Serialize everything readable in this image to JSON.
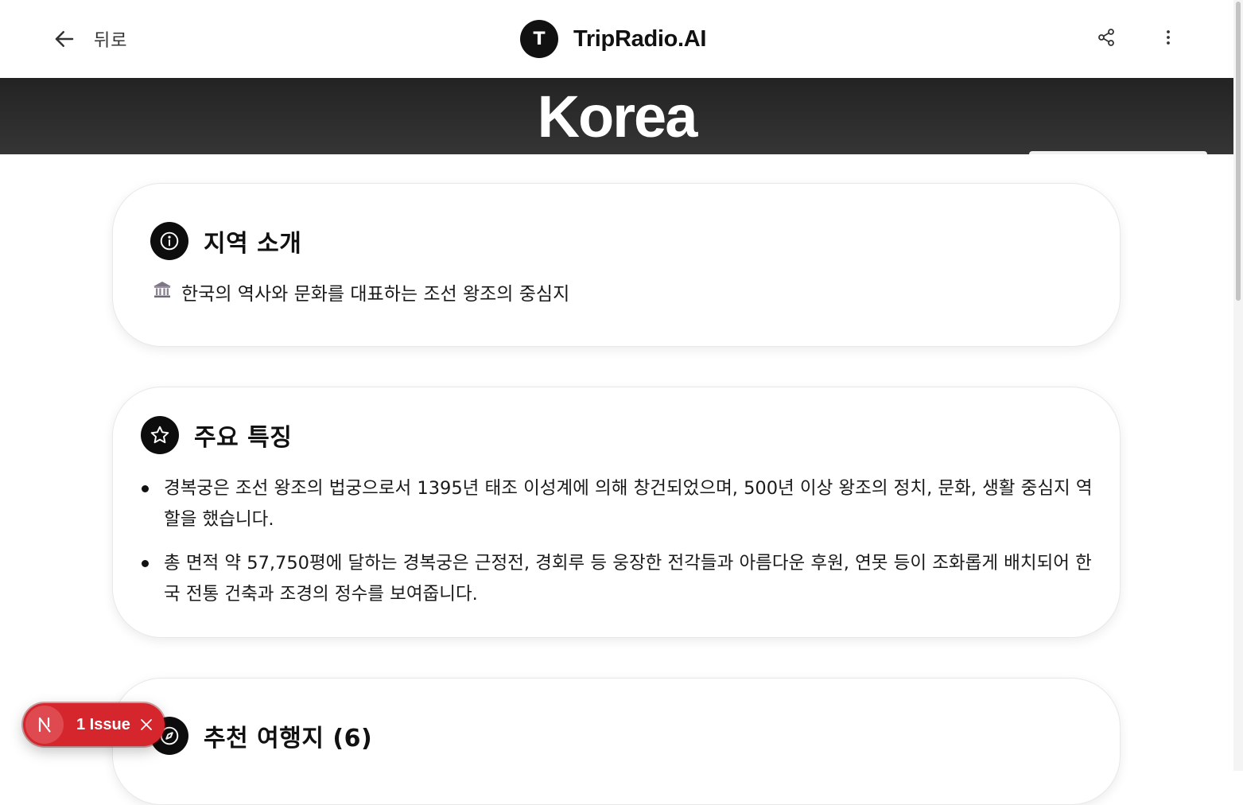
{
  "header": {
    "back_label": "뒤로",
    "brand_initial": "T",
    "brand_name": "TripRadio.AI"
  },
  "hero": {
    "title": "Korea"
  },
  "intro": {
    "title": "지역 소개",
    "emoji": "🏛",
    "description": "한국의 역사와 문화를 대표하는 조선 왕조의 중심지"
  },
  "features": {
    "title": "주요 특징",
    "items": [
      "경복궁은 조선 왕조의 법궁으로서 1395년 태조 이성계에 의해 창건되었으며, 500년 이상 왕조의 정치, 문화, 생활 중심지 역할을 했습니다.",
      "총 면적 약 57,750평에 달하는 경복궁은 근정전, 경회루 등 웅장한 전각들과 아름다운 후원, 연못 등이 조화롭게 배치되어 한국 전통 건축과 조경의 정수를 보여줍니다."
    ]
  },
  "recommend": {
    "title": "추천 여행지 (6)"
  },
  "issue_badge": {
    "label": "1 Issue"
  },
  "colors": {
    "hero_bg": "#2b2b2b",
    "icon_bg": "#0d0d0d",
    "issue_bg": "#d5262e"
  },
  "icons": {
    "back": "arrow-left-icon",
    "share": "share-icon",
    "more": "more-vertical-icon",
    "intro": "info-icon",
    "features": "star-icon",
    "recommend": "compass-icon",
    "issue_logo": "nextjs-logo-icon",
    "issue_close": "close-icon"
  }
}
